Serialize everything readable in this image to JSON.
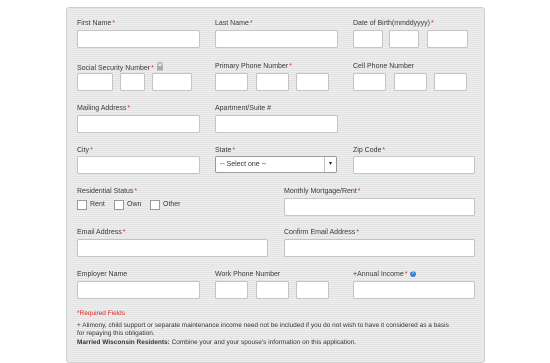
{
  "required_marker": "*",
  "fields": {
    "first_name": "First Name",
    "last_name": "Last Name",
    "dob": "Date of Birth(mmddyyyy)",
    "ssn": "Social Security Number",
    "primary_phone": "Primary Phone Number",
    "cell_phone": "Cell Phone Number",
    "mailing_address": "Mailing Address",
    "apartment": "Apartment/Suite #",
    "city": "City",
    "state": "State",
    "zip": "Zip Code",
    "residential_status": "Residential Status",
    "monthly_mortgage": "Monthly Mortgage/Rent",
    "email": "Email Address",
    "confirm_email": "Confirm Email Address",
    "employer": "Employer Name",
    "work_phone": "Work Phone Number",
    "annual_income": "+Annual Income"
  },
  "state_select": {
    "selected": "-- Select one --"
  },
  "residential_options": [
    "Rent",
    "Own",
    "Other"
  ],
  "footer": {
    "required_fields": "*Required Fields",
    "alimony_line1": "+ Alimony, child support or separate maintenance income need not be included if you do not wish to have it considered as a basis",
    "alimony_line2": "for repaying this obligation.",
    "wisconsin_bold": "Married Wisconsin Residents:",
    "wisconsin_text": " Combine your and your spouse's information on this application."
  },
  "icons": {
    "ssn_info": "lock-icon",
    "income_help": "help-icon"
  },
  "colors": {
    "required": "#dd2222",
    "help": "#3a7fcf"
  }
}
